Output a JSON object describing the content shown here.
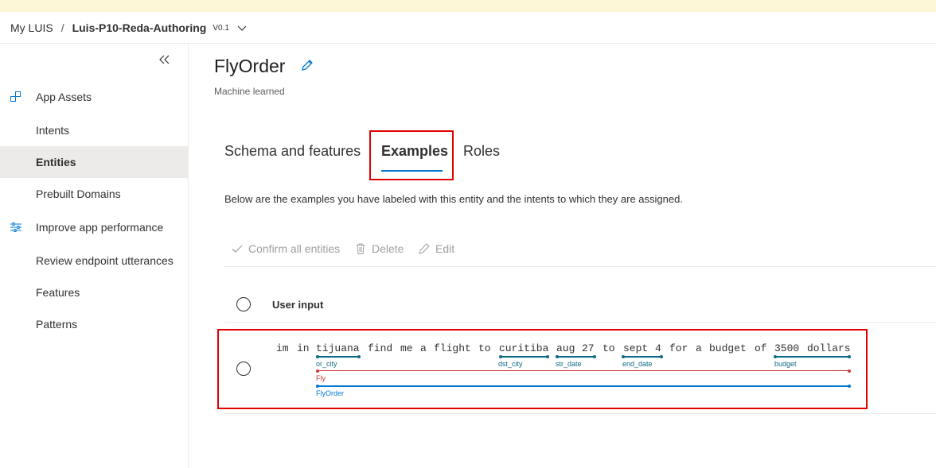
{
  "breadcrumb": {
    "root": "My LUIS",
    "separator": "/",
    "app": "Luis-P10-Reda-Authoring",
    "version": "V0.1"
  },
  "sidebar": {
    "items": [
      {
        "label": "App Assets",
        "icon": "app-assets-icon"
      },
      {
        "label": "Intents"
      },
      {
        "label": "Entities",
        "active": true
      },
      {
        "label": "Prebuilt Domains"
      },
      {
        "label": "Improve app performance",
        "icon": "sliders-icon"
      },
      {
        "label": "Review endpoint utterances"
      },
      {
        "label": "Features"
      },
      {
        "label": "Patterns"
      }
    ]
  },
  "entity": {
    "name": "FlyOrder",
    "type": "Machine learned"
  },
  "tabs": [
    {
      "label": "Schema and features"
    },
    {
      "label": "Examples",
      "active": true
    },
    {
      "label": "Roles"
    }
  ],
  "description": "Below are the examples you have labeled with this entity and the intents to which they are assigned.",
  "toolbar": {
    "confirm_label": "Confirm all entities",
    "delete_label": "Delete",
    "edit_label": "Edit"
  },
  "table": {
    "column_user_input": "User input"
  },
  "example": {
    "words": [
      "im",
      "in",
      "tijuana",
      "find",
      "me",
      "a",
      "flight",
      "to",
      "curitiba",
      "aug",
      "27",
      "to",
      "sept",
      "4",
      "for",
      "a",
      "budget",
      "of",
      "3500",
      "dollars"
    ],
    "entities": [
      {
        "label": "or_city"
      },
      {
        "label": "dst_city"
      },
      {
        "label": "str_date"
      },
      {
        "label": "end_date"
      },
      {
        "label": "budget"
      },
      {
        "label": "Fly"
      },
      {
        "label": "FlyOrder"
      }
    ]
  },
  "colors": {
    "accent": "#0078d4",
    "highlight_box": "#e00000",
    "entity_teal": "#0b6a83",
    "entity_red": "#d13438",
    "entity_blue": "#0078d4"
  }
}
